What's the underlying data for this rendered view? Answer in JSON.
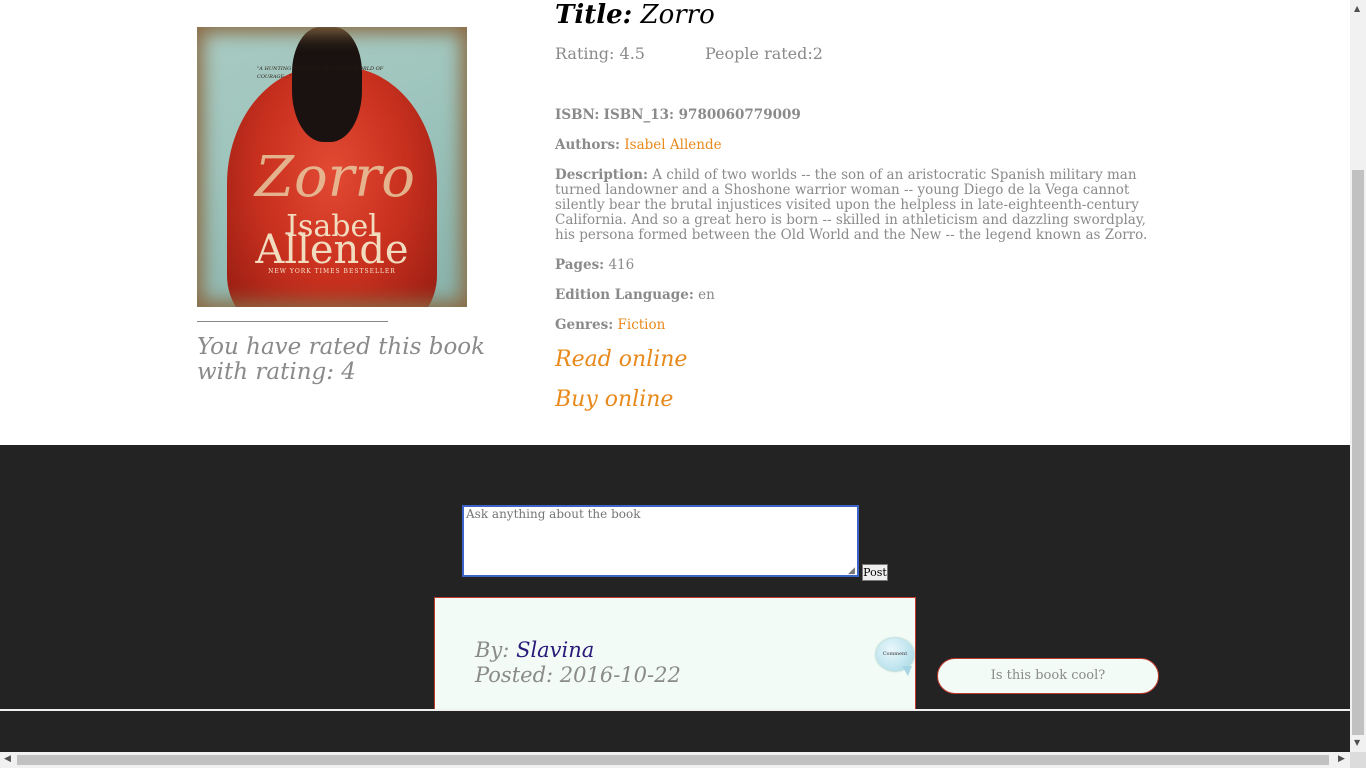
{
  "book": {
    "title_label": "Title:",
    "title": "Zorro",
    "rating_text": "Rating: 4.5",
    "people_rated_text": "People rated:2",
    "isbn_label": "ISBN:",
    "isbn_value": "ISBN_13: 9780060779009",
    "authors_label": "Authors:",
    "author": "Isabel Allende",
    "description_label": "Description:",
    "description": "A child of two worlds -- the son of an aristocratic Spanish military man turned landowner and a Shoshone warrior woman -- young Diego de la Vega cannot silently bear the brutal injustices visited upon the helpless in late-eighteenth-century California. And so a great hero is born -- skilled in athleticism and dazzling swordplay, his persona formed between the Old World and the New -- the legend known as Zorro.",
    "pages_label": "Pages:",
    "pages": "416",
    "language_label": "Edition Language:",
    "language": "en",
    "genres_label": "Genres:",
    "genre": "Fiction",
    "read_online": "Read online",
    "buy_online": "Buy online"
  },
  "cover": {
    "title": "Zorro",
    "author_first": "Isabel",
    "author_last": "Allende",
    "banner": "NEW YORK TIMES BESTSELLER"
  },
  "user_rating": {
    "text": "You have rated this book with rating: 4"
  },
  "question_form": {
    "placeholder": "Ask anything about the book",
    "post_label": "Post"
  },
  "comment": {
    "by_label": "By:",
    "author": "Slavina",
    "posted_text": "Posted: 2016-10-22",
    "bubble_label": "Comment",
    "question": "Is this book cool?"
  },
  "colors": {
    "link": "#e8891b",
    "dark_bg": "#232323",
    "card_bg": "#f2fbf6",
    "card_border": "#c0392b",
    "muted_text": "#8a8a8a"
  }
}
